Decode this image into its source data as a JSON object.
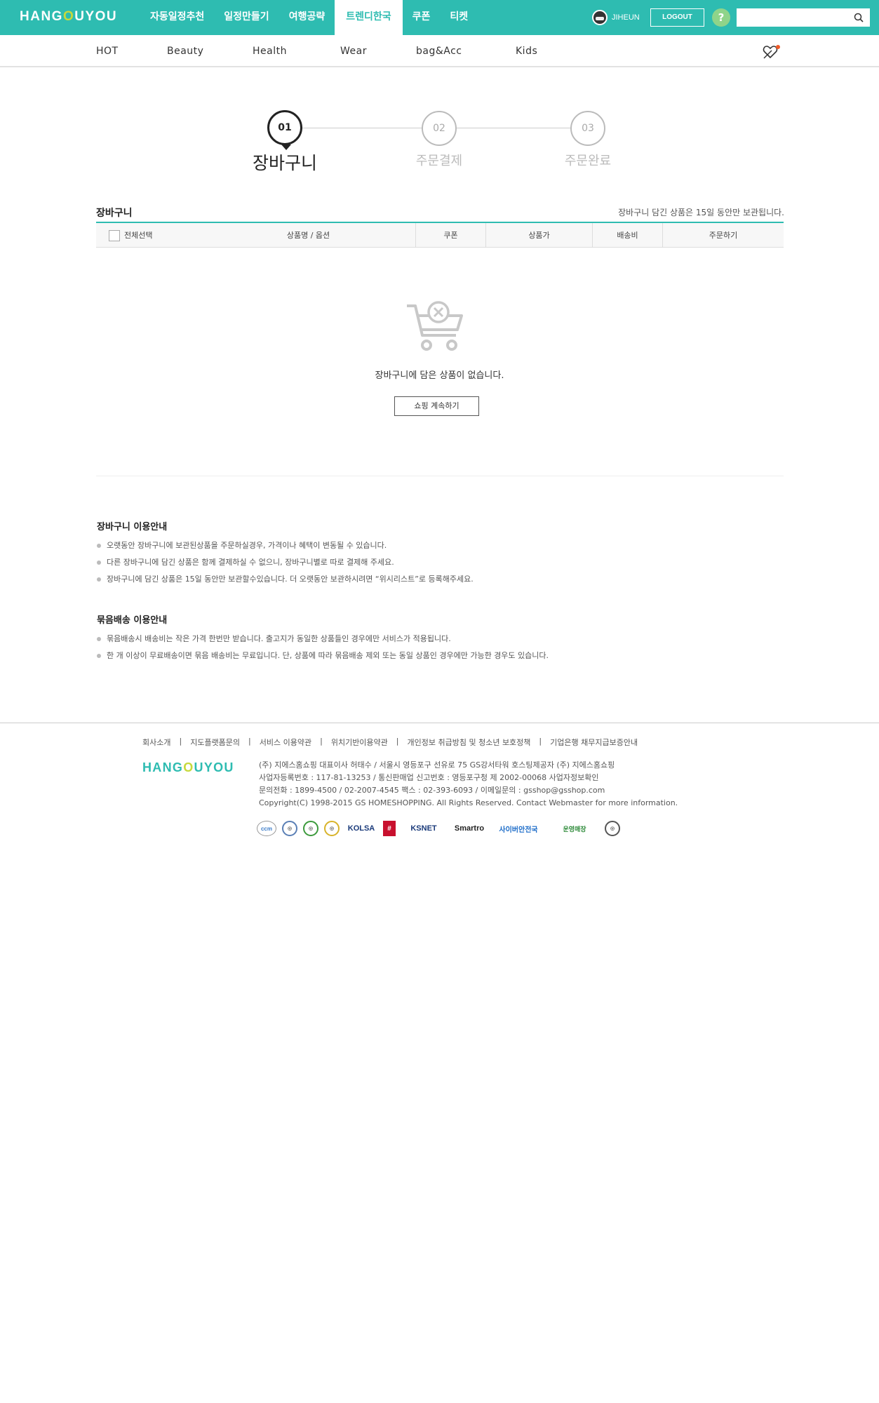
{
  "brand": {
    "logo_pre": "HANG",
    "logo_o": "O",
    "logo_post": "UYOU"
  },
  "main_nav": [
    "자동일정추천",
    "일정만들기",
    "여행공략",
    "트렌디한국",
    "쿠폰",
    "티켓"
  ],
  "active_nav": "트렌디한국",
  "user": {
    "name": "JIHEUN",
    "logout_label": "LOGOUT",
    "help_label": "?"
  },
  "search": {
    "placeholder": "",
    "value": ""
  },
  "categories": [
    "HOT",
    "Beauty",
    "Health",
    "Wear",
    "bag&Acc",
    "Kids"
  ],
  "steps": [
    {
      "num": "01",
      "label": "장바구니"
    },
    {
      "num": "02",
      "label": "주문결제"
    },
    {
      "num": "03",
      "label": "주문완료"
    }
  ],
  "cart": {
    "title": "장바구니",
    "note": "장바구니 담긴 상품은 15일 동안만 보관됩니다.",
    "columns": {
      "select_all": "전체선택",
      "product": "상품명 / 옵션",
      "coupon": "쿠폰",
      "price": "상품가",
      "shipping": "배송비",
      "order": "주문하기"
    },
    "empty_message": "장바구니에 담은 상품이 없습니다.",
    "continue_label": "쇼핑 계속하기"
  },
  "guide": {
    "title": "장바구니 이용안내",
    "items": [
      "오랫동안 장바구니에 보관된상품을 주문하실경우, 가격이나 혜택이 변동될 수 있습니다.",
      "다른 장바구니에 담긴 상품은 함께 결제하실 수 없으니, 장바구니별로 따로 결제해 주세요.",
      "장바구니에 담긴 상품은 15일 동안만 보관할수있습니다. 더 오랫동안 보관하시려면 “위시리스트”로 등록해주세요."
    ]
  },
  "bundle": {
    "title": "묶음배송 이용안내",
    "items": [
      "묶음배송시 배송비는 작은 가격 한번만 받습니다. 출고지가 동일한 상품들인 경우에만 서비스가 적용됩니다.",
      "한 개 이상이 무료배송이면 묶음 배송비는 무료입니다. 단, 상품에 따라 묶음배송 제외 또는 동일 상품인 경우에만 가능한 경우도 있습니다."
    ]
  },
  "footer": {
    "links": [
      "회사소개",
      "지도플랫폼문의",
      "서비스 이용약관",
      "위치기반이용약관",
      "개인정보 취급방침 및 청소년 보호정책",
      "기업은행 채무지급보증안내"
    ],
    "info": [
      "(주) 지에스홈쇼핑 대표이사 허태수 / 서울시 영등포구 선유로 75 GS강서타워 호스팅제공자 (주) 지에스홈쇼핑",
      "사업자등록번호 : 117-81-13253 / 통신판매업 신고번호 : 영등포구청 제 2002-00068 사업자정보확인",
      "문의전화 : 1899-4500 / 02-2007-4545 팩스 : 02-393-6093 / 이메일문의 : gsshop@gsshop.com",
      "Copyright(C) 1998-2015 GS HOMESHOPPING. All Rights Reserved. Contact Webmaster for more information."
    ],
    "badges": [
      "ccm",
      "KOLSA",
      "KSNET",
      "Smartro",
      "사이버안전국",
      "운영매장"
    ]
  },
  "colors": {
    "brand": "#2ebcb1",
    "logo_o": "#c7d93b",
    "alert_dot": "#f05a28"
  }
}
